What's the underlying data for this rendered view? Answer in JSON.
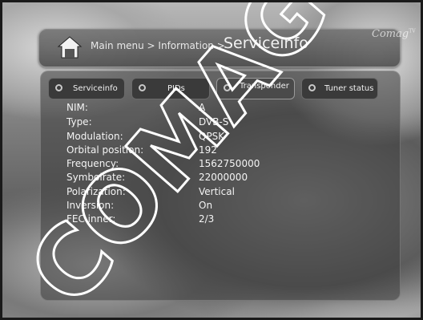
{
  "header": {
    "breadcrumb": "Main menu > Information >",
    "title": "Serviceinfo"
  },
  "logo": {
    "text": "Comag",
    "mark": "TV"
  },
  "tabs": [
    {
      "label": "Serviceinfo",
      "active": false
    },
    {
      "label": "PIDs",
      "active": false
    },
    {
      "label": "Transponder",
      "active": true
    },
    {
      "label": "Tuner status",
      "active": false
    }
  ],
  "info": [
    {
      "label": "NIM:",
      "value": "A"
    },
    {
      "label": "Type:",
      "value": "DVB-S"
    },
    {
      "label": "Modulation:",
      "value": "QPSK"
    },
    {
      "label": "Orbital position:",
      "value": "192"
    },
    {
      "label": "Frequency:",
      "value": "1562750000"
    },
    {
      "label": "Symbolrate:",
      "value": "22000000"
    },
    {
      "label": "Polarization:",
      "value": "Vertical"
    },
    {
      "label": "Inversion:",
      "value": "On"
    },
    {
      "label": "FEC inner:",
      "value": "2/3"
    }
  ],
  "watermark": {
    "text": "COMAG",
    "color": "#ffffff"
  }
}
